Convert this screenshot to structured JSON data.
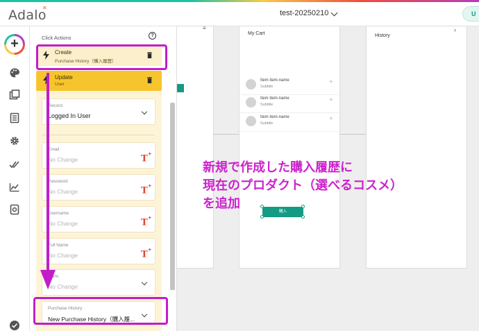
{
  "app": {
    "logo": "Adalo",
    "project_name": "test-20250210"
  },
  "panel": {
    "title": "Click Actions",
    "actions": [
      {
        "title": "Create",
        "subtitle": "Purchase History（購入履歴）"
      },
      {
        "title": "Update",
        "subtitle": "User"
      }
    ],
    "fields": [
      {
        "label": "Record",
        "value": "Logged In User",
        "control": "dropdown"
      },
      {
        "label": "Email",
        "value": "No Change",
        "control": "text"
      },
      {
        "label": "Password",
        "value": "No Change",
        "control": "text"
      },
      {
        "label": "Username",
        "value": "No Change",
        "control": "text"
      },
      {
        "label": "Full Name",
        "value": "No Change",
        "control": "text"
      },
      {
        "label": "Carts",
        "value": "No Change",
        "control": "dropdown"
      },
      {
        "label": "Purchase History",
        "value": "New Purchase History（購入履...",
        "control": "dropdown"
      }
    ]
  },
  "canvas": {
    "cart_screen": {
      "title": "My Cart",
      "items": [
        {
          "title": "Item item-name",
          "subtitle": "Subtitle"
        },
        {
          "title": "Item item-name",
          "subtitle": "Subtitle"
        },
        {
          "title": "Item item-name",
          "subtitle": "Subtitle"
        }
      ],
      "button_label": "購入"
    },
    "history_screen": {
      "title": "History"
    }
  },
  "annotation": {
    "lines": [
      "新規で作成した購入履歴に",
      "現在のプロダクト（選べるコスメ）",
      "を追加"
    ],
    "color": "#cc22cc"
  },
  "colors": {
    "accent": "#159a84",
    "update_bg": "#f6c52e",
    "create_bg": "#fbefcc",
    "highlight": "#c21dc9"
  }
}
